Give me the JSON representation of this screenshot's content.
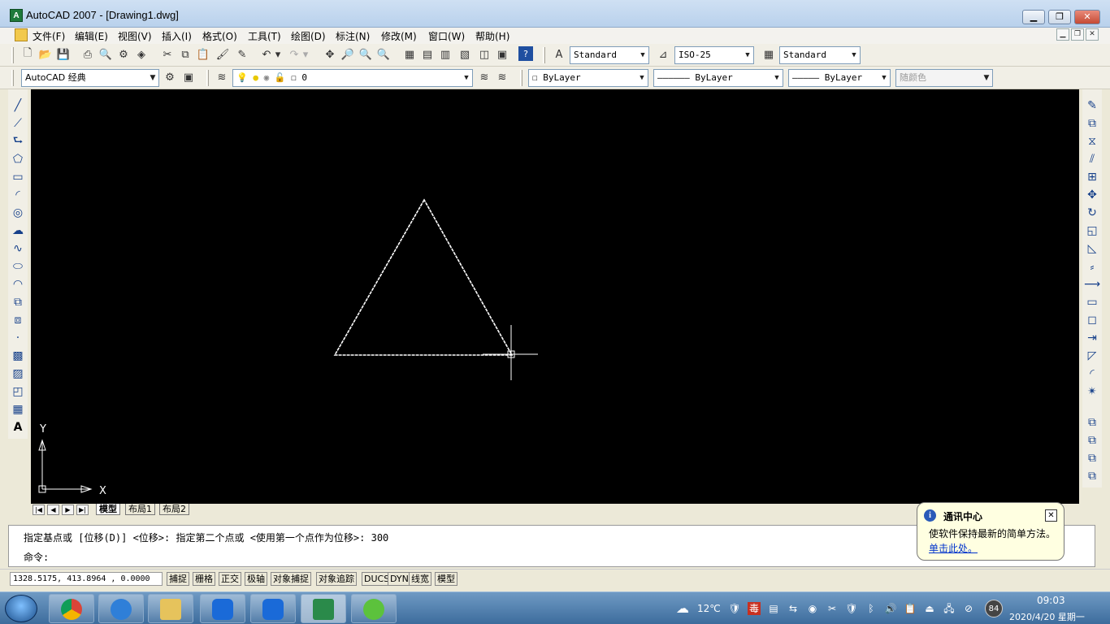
{
  "window": {
    "title": "AutoCAD 2007 - [Drawing1.dwg]",
    "minimize": "▁",
    "restore": "❐",
    "close": "✕"
  },
  "menu": {
    "items": [
      {
        "label": "文件(F)"
      },
      {
        "label": "编辑(E)"
      },
      {
        "label": "视图(V)"
      },
      {
        "label": "插入(I)"
      },
      {
        "label": "格式(O)"
      },
      {
        "label": "工具(T)"
      },
      {
        "label": "绘图(D)"
      },
      {
        "label": "标注(N)"
      },
      {
        "label": "修改(M)"
      },
      {
        "label": "窗口(W)"
      },
      {
        "label": "帮助(H)"
      }
    ]
  },
  "styles_toolbar": {
    "text_style": "Standard",
    "dim_style": "ISO-25",
    "table_style": "Standard"
  },
  "props_toolbar": {
    "workspace": "AutoCAD 经典",
    "layer": "0",
    "color": "ByLayer",
    "linetype": "ByLayer",
    "lineweight": "ByLayer",
    "plot_style": "随颜色"
  },
  "canvas": {
    "background": "#000000",
    "ucs_x": "X",
    "ucs_y": "Y"
  },
  "layout_tabs": [
    {
      "label": "模型",
      "active": true
    },
    {
      "label": "布局1",
      "active": false
    },
    {
      "label": "布局2",
      "active": false
    }
  ],
  "command": {
    "history": "指定基点或 [位移(D)] <位移>:  指定第二个点或 <使用第一个点作为位移>: 300",
    "prompt": "命令:"
  },
  "status": {
    "coords": "1328.5175, 413.8964 , 0.0000",
    "toggles": [
      "捕捉",
      "栅格",
      "正交",
      "极轴",
      "对象捕捉",
      "对象追踪",
      "DUCS",
      "DYN",
      "线宽",
      "模型"
    ]
  },
  "comm_center": {
    "title": "通讯中心",
    "message": "使软件保持最新的简单方法。",
    "link": "单击此处。"
  },
  "taskbar": {
    "temperature": "12℃",
    "time": "09:03",
    "date": "2020/4/20 星期一",
    "badge": "84"
  }
}
